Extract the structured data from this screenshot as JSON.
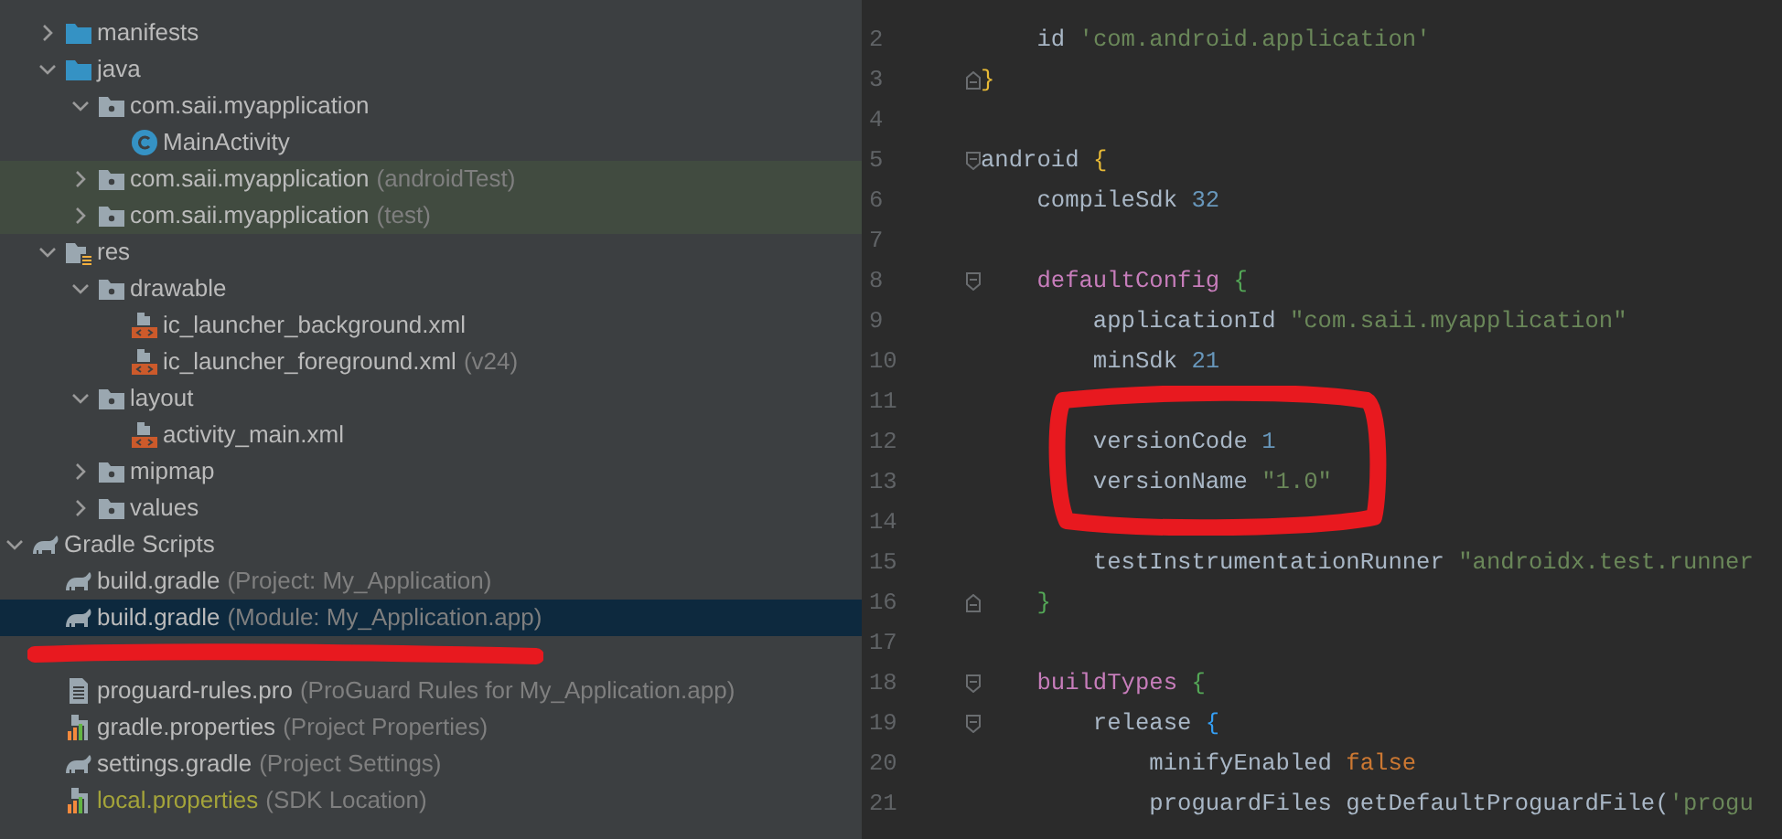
{
  "project_tree": [
    {
      "children": [
        {
          "label": "manifests",
          "kind": "folder",
          "expanded": false
        },
        {
          "label": "java",
          "kind": "folder",
          "expanded": true,
          "children": [
            {
              "label": "com.saii.myapplication",
              "kind": "package",
              "expanded": true,
              "children": [
                {
                  "label": "MainActivity",
                  "kind": "class"
                }
              ]
            },
            {
              "label": "com.saii.myapplication",
              "hint": "(androidTest)",
              "kind": "package",
              "expanded": false,
              "test_scope": true
            },
            {
              "label": "com.saii.myapplication",
              "hint": "(test)",
              "kind": "package",
              "expanded": false,
              "test_scope": true
            }
          ]
        },
        {
          "label": "res",
          "kind": "res-folder",
          "expanded": true,
          "children": [
            {
              "label": "drawable",
              "kind": "package",
              "expanded": true,
              "children": [
                {
                  "label": "ic_launcher_background.xml",
                  "kind": "xml"
                },
                {
                  "label": "ic_launcher_foreground.xml",
                  "hint": "(v24)",
                  "kind": "xml"
                }
              ]
            },
            {
              "label": "layout",
              "kind": "package",
              "expanded": true,
              "children": [
                {
                  "label": "activity_main.xml",
                  "kind": "xml"
                }
              ]
            },
            {
              "label": "mipmap",
              "kind": "package",
              "expanded": false
            },
            {
              "label": "values",
              "kind": "package",
              "expanded": false
            }
          ]
        }
      ]
    },
    {
      "label": "Gradle Scripts",
      "kind": "gradle",
      "expanded": true,
      "children": [
        {
          "label": "build.gradle",
          "hint": "(Project: My_Application)",
          "kind": "gradle",
          "selected": false
        },
        {
          "label": "build.gradle",
          "hint": "(Module: My_Application.app)",
          "kind": "gradle",
          "selected": true
        },
        {
          "kind": "redacted"
        },
        {
          "label": "proguard-rules.pro",
          "hint": "(ProGuard Rules for My_Application.app)",
          "kind": "text-file",
          "selected": false
        },
        {
          "label": "gradle.properties",
          "hint": "(Project Properties)",
          "kind": "properties",
          "selected": false
        },
        {
          "label": "settings.gradle",
          "hint": "(Project Settings)",
          "kind": "gradle",
          "selected": false
        },
        {
          "label": "local.properties",
          "hint": "(SDK Location)",
          "kind": "properties",
          "selected": false,
          "ignored": true
        }
      ]
    }
  ],
  "editor": {
    "lines": [
      {
        "number": "2",
        "kind": "code",
        "tokens": [
          {
            "kind": "plain",
            "text": "    id "
          },
          {
            "kind": "string",
            "text": "'com.android.application'"
          }
        ]
      },
      {
        "number": "3",
        "kind": "fold-end",
        "tokens": [
          {
            "kind": "brace-yellow",
            "text": "}"
          }
        ]
      },
      {
        "number": "4",
        "kind": "blank"
      },
      {
        "number": "5",
        "kind": "fold-start",
        "tokens": [
          {
            "kind": "plain",
            "text": "android "
          },
          {
            "kind": "brace-yellow",
            "text": "{"
          }
        ]
      },
      {
        "number": "6",
        "kind": "code",
        "tokens": [
          {
            "kind": "plain",
            "text": "    compileSdk "
          },
          {
            "kind": "number",
            "text": "32"
          }
        ]
      },
      {
        "number": "7",
        "kind": "blank"
      },
      {
        "number": "8",
        "kind": "fold-start",
        "tokens": [
          {
            "kind": "keyword",
            "text": "    defaultConfig "
          },
          {
            "kind": "brace-green",
            "text": "{"
          }
        ]
      },
      {
        "number": "9",
        "kind": "code",
        "tokens": [
          {
            "kind": "plain",
            "text": "        applicationId "
          },
          {
            "kind": "string",
            "text": "\"com.saii.myapplication\""
          }
        ]
      },
      {
        "number": "10",
        "kind": "code",
        "tokens": [
          {
            "kind": "plain",
            "text": "        minSdk "
          },
          {
            "kind": "number",
            "text": "21"
          }
        ]
      },
      {
        "number": "11",
        "kind": "blank"
      },
      {
        "number": "12",
        "kind": "code",
        "tokens": [
          {
            "kind": "plain",
            "text": "        versionCode "
          },
          {
            "kind": "number",
            "text": "1"
          }
        ]
      },
      {
        "number": "13",
        "kind": "code",
        "tokens": [
          {
            "kind": "plain",
            "text": "        versionName "
          },
          {
            "kind": "string",
            "text": "\"1.0\""
          }
        ]
      },
      {
        "number": "14",
        "kind": "blank"
      },
      {
        "number": "15",
        "kind": "code",
        "tokens": [
          {
            "kind": "plain",
            "text": "        testInstrumentationRunner "
          },
          {
            "kind": "string",
            "text": "\"androidx.test.runner"
          }
        ]
      },
      {
        "number": "16",
        "kind": "fold-end",
        "tokens": [
          {
            "kind": "brace-green",
            "text": "    }"
          }
        ]
      },
      {
        "number": "17",
        "kind": "blank"
      },
      {
        "number": "18",
        "kind": "fold-start",
        "tokens": [
          {
            "kind": "keyword",
            "text": "    buildTypes "
          },
          {
            "kind": "brace-green",
            "text": "{"
          }
        ]
      },
      {
        "number": "19",
        "kind": "fold-start",
        "tokens": [
          {
            "kind": "plain",
            "text": "        release "
          },
          {
            "kind": "brace-blue",
            "text": "{"
          }
        ]
      },
      {
        "number": "20",
        "kind": "code",
        "tokens": [
          {
            "kind": "plain",
            "text": "            minifyEnabled "
          },
          {
            "kind": "literal",
            "text": "false"
          }
        ]
      },
      {
        "number": "21",
        "kind": "code",
        "tokens": [
          {
            "kind": "plain",
            "text": "            proguardFiles getDefaultProguardFile("
          },
          {
            "kind": "string",
            "text": "'progu"
          }
        ]
      }
    ],
    "annotation": {
      "kind": "ring"
    }
  }
}
